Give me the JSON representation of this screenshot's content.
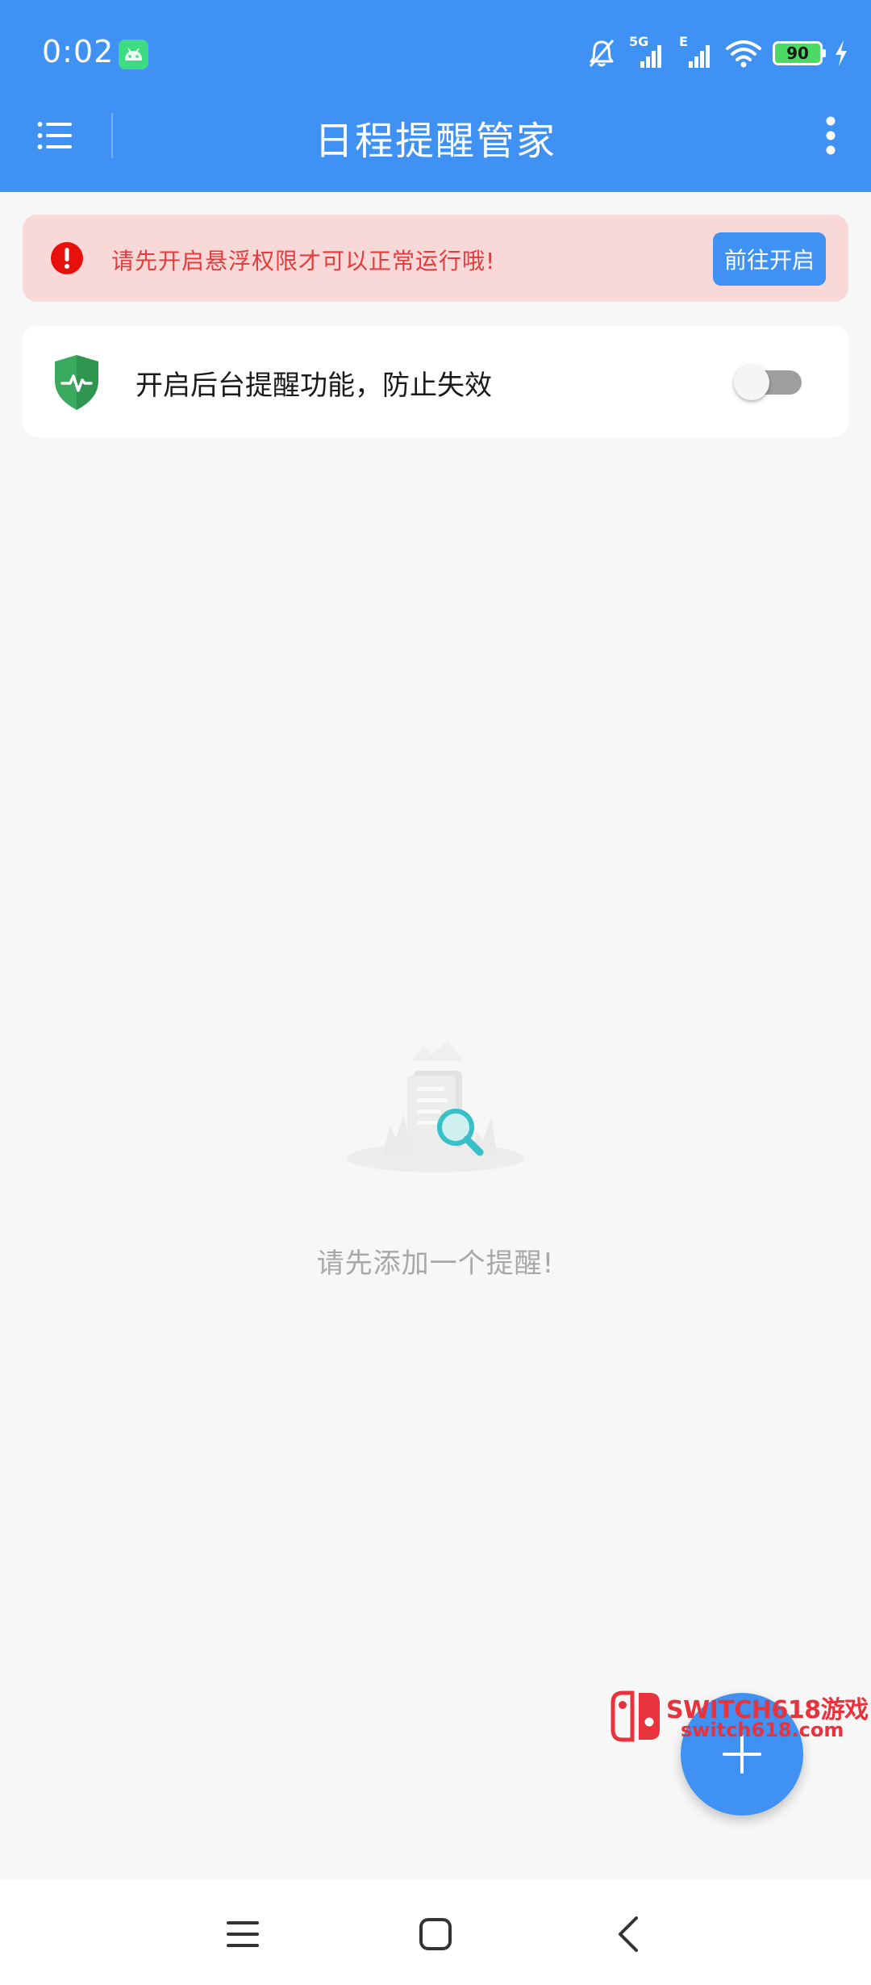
{
  "status_bar": {
    "time": "0:02",
    "network_primary": "5G",
    "network_secondary": "E",
    "battery_level": "90",
    "icons": [
      "android-icon",
      "bell-off-icon",
      "signal-icon",
      "signal-icon",
      "wifi-icon",
      "battery-icon",
      "charging-icon"
    ]
  },
  "app_bar": {
    "title": "日程提醒管家",
    "icons": [
      "menu-icon",
      "more-vert-icon"
    ]
  },
  "warning_banner": {
    "message": "请先开启悬浮权限才可以正常运行哦!",
    "button_label": "前往开启",
    "icon": "alert-icon"
  },
  "background_card": {
    "label": "开启后台提醒功能，防止失效",
    "toggle_on": false,
    "icon": "shield-pulse-icon"
  },
  "empty_state": {
    "message": "请先添加一个提醒!",
    "icon": "document-search-illustration"
  },
  "fab": {
    "icon": "plus-icon"
  },
  "watermark": {
    "title": "SWITCH618游戏",
    "url": "switch618.com"
  },
  "nav_bar": {
    "icons": [
      "recents-icon",
      "home-icon",
      "back-icon"
    ]
  },
  "colors": {
    "primary": "#3f92f3",
    "background": "#f7f7f7",
    "warning_bg": "#f9d8d8",
    "warning_text": "#e33c3c",
    "shield": "#3aaa5e",
    "empty_text": "#a8a8a8"
  }
}
